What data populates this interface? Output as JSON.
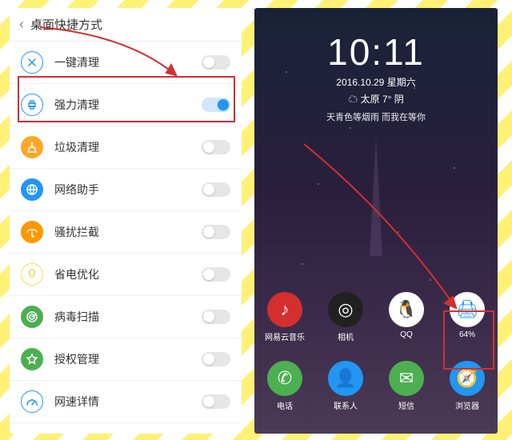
{
  "left": {
    "title": "桌面快捷方式",
    "items": [
      {
        "label": "一键清理",
        "icon": "x",
        "bg": "#fff",
        "bd": "#2196f3",
        "fg": "#2196f3",
        "on": false
      },
      {
        "label": "强力清理",
        "icon": "printer",
        "bg": "#fff",
        "bd": "#2196f3",
        "fg": "#2196f3",
        "on": true
      },
      {
        "label": "垃圾清理",
        "icon": "broom",
        "bg": "#ffa726",
        "bd": "#ffa726",
        "fg": "#fff",
        "on": false
      },
      {
        "label": "网络助手",
        "icon": "globe",
        "bg": "#2196f3",
        "bd": "#2196f3",
        "fg": "#fff",
        "on": false
      },
      {
        "label": "骚扰拦截",
        "icon": "umbrella",
        "bg": "#ff9800",
        "bd": "#ff9800",
        "fg": "#fff",
        "on": false
      },
      {
        "label": "省电优化",
        "icon": "bulb",
        "bg": "#fff",
        "bd": "#ffd54f",
        "fg": "#ffd54f",
        "on": false
      },
      {
        "label": "病毒扫描",
        "icon": "radar",
        "bg": "#4caf50",
        "bd": "#4caf50",
        "fg": "#fff",
        "on": false
      },
      {
        "label": "授权管理",
        "icon": "star",
        "bg": "#4caf50",
        "bd": "#4caf50",
        "fg": "#fff",
        "on": false
      },
      {
        "label": "网速详情",
        "icon": "speed",
        "bg": "#fff",
        "bd": "#2196f3",
        "fg": "#2196f3",
        "on": false
      }
    ]
  },
  "right": {
    "time": "10:11",
    "date": "2016.10.29 星期六",
    "weather": "太原 7° 阴",
    "lyric": "天青色等烟雨 而我在等你",
    "weather_icon": "☁",
    "row1": [
      {
        "label": "网易云音乐",
        "bg": "#d32f2f",
        "glyph": "♪"
      },
      {
        "label": "相机",
        "bg": "#212121",
        "glyph": "◎"
      },
      {
        "label": "QQ",
        "bg": "#fff",
        "glyph": "🐧"
      },
      {
        "label": "64%",
        "bg": "#fff",
        "glyph": "🖨",
        "fg": "#2196f3"
      }
    ],
    "row2": [
      {
        "label": "电话",
        "bg": "#4caf50",
        "glyph": "✆"
      },
      {
        "label": "联系人",
        "bg": "#2196f3",
        "glyph": "👤"
      },
      {
        "label": "短信",
        "bg": "#4caf50",
        "glyph": "✉"
      },
      {
        "label": "浏览器",
        "bg": "#2196f3",
        "glyph": "🧭"
      }
    ]
  }
}
